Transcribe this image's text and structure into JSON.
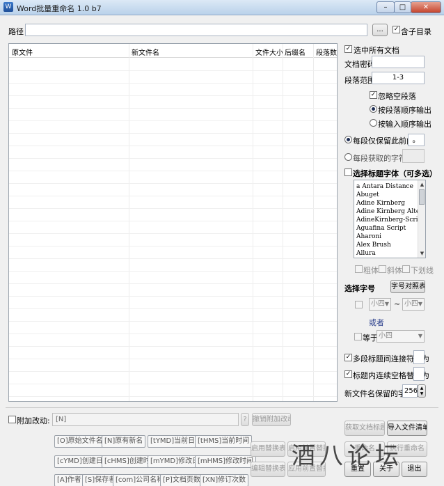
{
  "window": {
    "title": "Word批量重命名 1.0 b7",
    "icon_glyph": "W",
    "minimize_glyph": "–",
    "maximize_glyph": "□",
    "close_glyph": "✕"
  },
  "path": {
    "label": "路径",
    "value": "",
    "browse_label": "...",
    "subdir_label": "含子目录",
    "subdir_checked": true
  },
  "table": {
    "columns": [
      "原文件",
      "新文件名",
      "文件大小",
      "后缀名",
      "段落数"
    ],
    "rows": []
  },
  "options": {
    "select_all_docs": "选中所有文档",
    "doc_password_label": "文档密码",
    "doc_password_value": "",
    "para_range_label": "段落范围",
    "para_range_value": "1-3",
    "ignore_empty": "忽略空段落",
    "order_by_para": "按段落顺序输出",
    "order_by_input": "按输入顺序输出",
    "keep_before_label": "每段仅保留此前内容",
    "keep_before_value": "。",
    "char_count_label": "每段获取的字符数",
    "char_count_value": "",
    "heading_font_label": "选择标题字体（可多选）",
    "fonts": [
      "a Antara Distance",
      "Abuget",
      "Adine Kirnberg",
      "Adine Kirnberg Altern",
      "AdineKirnberg-Script",
      "Aguafina Script",
      "Aharoni",
      "Alex Brush",
      "Allura"
    ],
    "bold": "粗体",
    "italic": "斜体",
    "underline": "下划线",
    "font_size_label": "选择字号",
    "font_size_table_btn": "字号对照表",
    "size_from": "小四",
    "size_to": "小四",
    "range_sep": "~",
    "or_label": "或者",
    "equal_label": "等于",
    "equal_value": "小四",
    "multi_para_join_label": "多段标题间连接符设为",
    "multi_para_join_value": "",
    "inner_space_label": "标题内连续空格替换为",
    "inner_space_value": "",
    "keep_chars_label": "新文件名保留的字符数",
    "keep_chars_value": "256"
  },
  "bottom": {
    "append_label": "附加改动:",
    "append_value": "[N]",
    "help_btn": "?",
    "cancel_append_btn": "撤销附加改动",
    "tokens_row1": [
      "[O]原始文件名",
      "[N]原有新名",
      "[tYMD]当前日期",
      "[tHMS]当前时间"
    ],
    "tokens_row2": [
      "[cYMD]创建日期",
      "[cHMS]创建时间",
      "[mYMD]修改日期",
      "[mHMS]修改时间"
    ],
    "tokens_row3": [
      "[A]作者",
      "[S]保存者",
      "[com]公司名称",
      "[P]文档页数",
      "[XN]修订次数"
    ],
    "enable_replace_btn": "启用替换表",
    "edit_replace_btn": "编辑替换表",
    "extra_btn_1": "启用前置替换",
    "extra_btn_2": "应用前置替换",
    "get_title_btn": "获取文档标题",
    "import_list_btn": "导入文件清单",
    "preview_btn": "重命名",
    "execute_btn": "执行重命名",
    "reset_btn": "重置",
    "about_btn": "关于",
    "exit_btn": "退出",
    "watermark": "酒八论坛"
  }
}
